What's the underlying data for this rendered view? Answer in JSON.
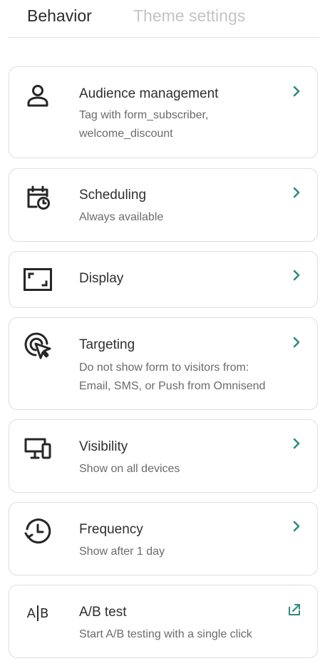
{
  "tabs": {
    "behavior": "Behavior",
    "theme": "Theme settings"
  },
  "colors": {
    "accent": "#2c8a83",
    "border": "#dedede",
    "muted_text": "#6b6b6b",
    "inactive_tab": "#c4c4c4"
  },
  "cards": [
    {
      "title": "Audience management",
      "desc1": "Tag with form_subscriber,",
      "desc2": "welcome_discount",
      "icon": "user-icon",
      "action_icon": "chevron-right-icon"
    },
    {
      "title": "Scheduling",
      "desc1": "Always available",
      "icon": "calendar-clock-icon",
      "action_icon": "chevron-right-icon"
    },
    {
      "title": "Display",
      "icon": "frame-corners-icon",
      "action_icon": "chevron-right-icon"
    },
    {
      "title": "Targeting",
      "desc1": "Do not show form to visitors from:",
      "desc2": "Email, SMS, or Push from Omnisend",
      "icon": "target-cursor-icon",
      "action_icon": "chevron-right-icon"
    },
    {
      "title": "Visibility",
      "desc1": "Show on all devices",
      "icon": "devices-icon",
      "action_icon": "chevron-right-icon"
    },
    {
      "title": "Frequency",
      "desc1": "Show after 1 day",
      "icon": "history-clock-icon",
      "action_icon": "chevron-right-icon"
    },
    {
      "title": "A/B test",
      "desc1": "Start A/B testing with a single click",
      "icon": "ab-test-icon",
      "icon_text_a": "A",
      "icon_text_b": "B",
      "action_icon": "external-link-icon"
    }
  ]
}
